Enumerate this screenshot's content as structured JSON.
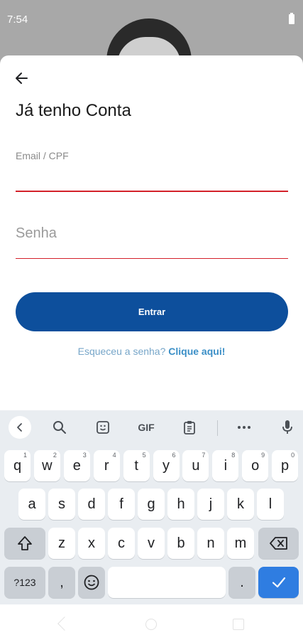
{
  "status": {
    "time": "7:54"
  },
  "sheet": {
    "title": "Já tenho Conta",
    "email_label": "Email / CPF",
    "password_placeholder": "Senha",
    "enter_label": "Entrar",
    "forgot_text": "Esqueceu a senha?",
    "forgot_link": "Clique aqui!"
  },
  "keyboard": {
    "toolbar": {
      "gif_label": "GIF"
    },
    "row1": [
      {
        "k": "q",
        "h": "1"
      },
      {
        "k": "w",
        "h": "2"
      },
      {
        "k": "e",
        "h": "3"
      },
      {
        "k": "r",
        "h": "4"
      },
      {
        "k": "t",
        "h": "5"
      },
      {
        "k": "y",
        "h": "6"
      },
      {
        "k": "u",
        "h": "7"
      },
      {
        "k": "i",
        "h": "8"
      },
      {
        "k": "o",
        "h": "9"
      },
      {
        "k": "p",
        "h": "0"
      }
    ],
    "row2": [
      "a",
      "s",
      "d",
      "f",
      "g",
      "h",
      "j",
      "k",
      "l"
    ],
    "row3": [
      "z",
      "x",
      "c",
      "v",
      "b",
      "n",
      "m"
    ],
    "symbols_label": "?123",
    "comma": ",",
    "period": "."
  },
  "colors": {
    "primary_button": "#0d4f9c",
    "input_underline": "#d3212a",
    "link": "#3b8fc7",
    "enter_key": "#2f7de1"
  }
}
